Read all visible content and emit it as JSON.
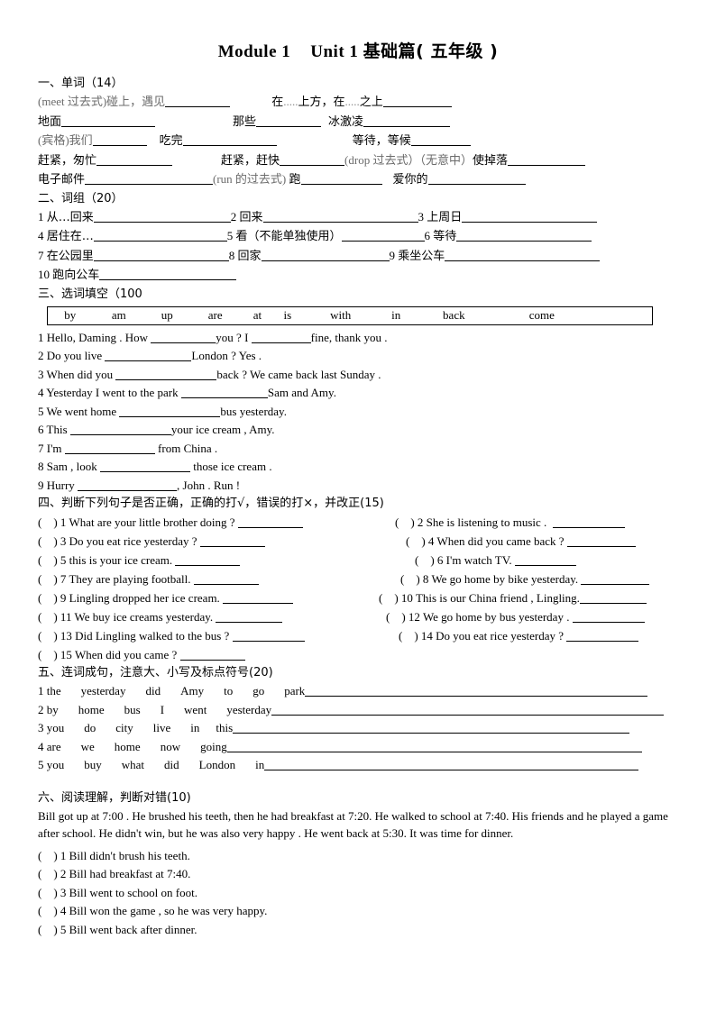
{
  "document": {
    "title_part1": "Module 1",
    "title_part2": "Unit 1",
    "title_part3": "基础篇( 五年级 )"
  },
  "section1": {
    "heading": "一、单词（14）",
    "items": [
      {
        "hint": "(meet  过去式)",
        "cn": "碰上，遇见",
        "blank": 72
      },
      {
        "hint": "",
        "cn": "在",
        "dots": ".....",
        "cn2": "上方，在",
        "dots2": ".....",
        "cn3": "之上",
        "blank": 76
      },
      {
        "hint": "",
        "cn": "地面",
        "blank": 104
      },
      {
        "hint": "",
        "cn": "那些",
        "blank": 72
      },
      {
        "hint": "",
        "cn": "冰激凌",
        "blank": 96
      },
      {
        "hint": "(宾格)",
        "cn": "我们",
        "blank": 60
      },
      {
        "hint": "",
        "cn": "吃完",
        "blank": 104
      },
      {
        "hint": "",
        "cn": "等待，等候",
        "blank": 66
      },
      {
        "hint": "",
        "cn": "赶紧，匆忙",
        "blank": 84
      },
      {
        "hint": "",
        "cn": "赶紧，赶快",
        "blank": 72
      },
      {
        "hint": "(drop  过去式）（无意中）",
        "cn": "使掉落",
        "blank": 86
      },
      {
        "hint": "",
        "cn": "电子邮件",
        "blank": 142
      },
      {
        "hint": "(run  的过去式)",
        "cn": "跑",
        "blank": 90
      },
      {
        "hint": "",
        "cn": "爱你的",
        "blank": 108
      }
    ],
    "line2_label_a": "(meet  过去式)碰上，遇见",
    "line2_label_b": "在",
    "line2_label_c": "上方，在",
    "line2_label_d": "之上",
    "line3_a": "地面",
    "line3_b": "那些",
    "line3_c": "冰激凌",
    "line4_a": "(宾格)我们",
    "line4_b": "吃完",
    "line4_c": "等待，等候",
    "line5_a": "赶紧，匆忙",
    "line5_b": "赶紧，赶快",
    "line5_c_hint": "(drop  过去式）（无意中）",
    "line5_c": "使掉落",
    "line6_a": "电子邮件",
    "line6_b_hint": "(run  的过去式)",
    "line6_b": "跑",
    "line6_c": "爱你的"
  },
  "section2": {
    "heading": "二、词组（20）",
    "items": [
      {
        "num": "1",
        "text": "从…回来"
      },
      {
        "num": "2",
        "text": "回来"
      },
      {
        "num": "3",
        "text": "上周日"
      },
      {
        "num": "4",
        "text": "居住在…"
      },
      {
        "num": "5",
        "text": "看（不能单独使用）"
      },
      {
        "num": "6",
        "text": "等待"
      },
      {
        "num": "7",
        "text": "在公园里"
      },
      {
        "num": "8",
        "text": "回家"
      },
      {
        "num": "9",
        "text": "乘坐公车"
      },
      {
        "num": "10",
        "text": "跑向公车"
      }
    ]
  },
  "section3": {
    "heading": "三、选词填空（100",
    "wordbank": [
      "by",
      "am",
      "up",
      "are",
      "at",
      "is",
      "with",
      "in",
      "back",
      "come"
    ],
    "sentences": [
      {
        "num": "1",
        "pre": "Hello, Daming . How",
        "blank1": 72,
        "mid": "you ? I",
        "blank2": 66,
        "post": "fine, thank you ."
      },
      {
        "num": "2",
        "pre": "Do you live",
        "blank1": 96,
        "mid": "London ? Yes .",
        "blank2": 0,
        "post": ""
      },
      {
        "num": "3",
        "pre": "When did you",
        "blank1": 112,
        "mid": "back ?   We came back last Sunday .",
        "blank2": 0,
        "post": ""
      },
      {
        "num": "4",
        "pre": "Yesterday I went to the park",
        "blank1": 96,
        "mid": "Sam and Amy.",
        "blank2": 0,
        "post": ""
      },
      {
        "num": "5",
        "pre": "We went home",
        "blank1": 112,
        "mid": "bus yesterday.",
        "blank2": 0,
        "post": ""
      },
      {
        "num": "6",
        "pre": "This",
        "blank1": 112,
        "mid": "your ice cream , Amy.",
        "blank2": 0,
        "post": ""
      },
      {
        "num": "7",
        "pre": "I'm",
        "blank1": 100,
        "mid": " from China .",
        "blank2": 0,
        "post": ""
      },
      {
        "num": "8",
        "pre": "Sam , look",
        "blank1": 100,
        "mid": " those ice cream .",
        "blank2": 0,
        "post": ""
      },
      {
        "num": "9",
        "pre": "Hurry",
        "blank1": 110,
        "mid": ", John . Run !",
        "blank2": 0,
        "post": ""
      }
    ]
  },
  "section4": {
    "heading": "四、判断下列句子是否正确，正确的打√，错误的打×，并改正(15)",
    "items": [
      {
        "num": "1",
        "text": "What are your little brother doing ?",
        "blank": 72,
        "col": "left",
        "indent": 0
      },
      {
        "num": "2",
        "text": "She is listening to music .",
        "blank": 80,
        "col": "right",
        "indent": 0
      },
      {
        "num": "3",
        "text": "Do you eat rice yesterday ?",
        "blank": 72,
        "col": "left",
        "indent": 0
      },
      {
        "num": "4",
        "text": "When did you came back ?",
        "blank": 76,
        "col": "right",
        "indent": 12
      },
      {
        "num": "5",
        "text": "this is your ice cream.",
        "blank": 72,
        "col": "left",
        "indent": 0
      },
      {
        "num": "6",
        "text": "I'm watch TV.",
        "blank": 68,
        "col": "right",
        "indent": 24
      },
      {
        "num": "7",
        "text": "They are playing football.",
        "blank": 72,
        "col": "left",
        "indent": 0
      },
      {
        "num": "8",
        "text": "We go home by bike yesterday.",
        "blank": 76,
        "col": "right",
        "indent": 10
      },
      {
        "num": "9",
        "text": "Lingling dropped her ice cream.",
        "blank": 78,
        "col": "left",
        "indent": 0
      },
      {
        "num": "10",
        "text": "This is our China friend , Lingling.",
        "blank": 74,
        "col": "right",
        "indent": -16
      },
      {
        "num": "11",
        "text": "We buy ice creams yesterday.",
        "blank": 74,
        "col": "left",
        "indent": 0
      },
      {
        "num": "12",
        "text": "We go home by bus yesterday .",
        "blank": 80,
        "col": "right",
        "indent": -8
      },
      {
        "num": "13",
        "text": "Did Lingling walked to the bus ?",
        "blank": 80,
        "col": "left",
        "indent": 0
      },
      {
        "num": "14",
        "text": "Do you eat rice yesterday ?",
        "blank": 80,
        "col": "right",
        "indent": 6
      },
      {
        "num": "15",
        "text": "When did you came ?",
        "blank": 72,
        "col": "left",
        "indent": 0
      }
    ]
  },
  "section5": {
    "heading": "五、连词成句，注意大、小写及标点符号(20)",
    "items": [
      {
        "num": "1",
        "words": [
          "the",
          "yesterday",
          "did",
          "Amy",
          "to",
          "go",
          "park"
        ],
        "blank": 380
      },
      {
        "num": "2",
        "words": [
          "by",
          "home",
          "bus",
          "I",
          "went",
          "yesterday"
        ],
        "blank": 435
      },
      {
        "num": "3",
        "words": [
          "you",
          "do",
          "city",
          "live",
          "in",
          "this"
        ],
        "blank": 440
      },
      {
        "num": "4",
        "words": [
          "are",
          "we",
          "home",
          "now",
          "going"
        ],
        "blank": 460
      },
      {
        "num": "5",
        "words": [
          "you",
          "buy",
          "what",
          "did",
          "London",
          "in"
        ],
        "blank": 415
      }
    ]
  },
  "section6": {
    "heading": "六、阅读理解，判断对错(10)",
    "passage": "Bill got up at 7:00 . He brushed his teeth, then he had breakfast at 7:20. He walked to school at 7:40. His friends and he played a game after school. He didn't win, but he was also very happy . He went back at 5:30. It was time for dinner.",
    "items": [
      {
        "num": "1",
        "text": "Bill didn't brush his teeth."
      },
      {
        "num": "2",
        "text": "Bill had breakfast at 7:40."
      },
      {
        "num": "3",
        "text": "Bill went to school on foot."
      },
      {
        "num": "4",
        "text": "Bill won the game , so he was very happy."
      },
      {
        "num": "5",
        "text": "Bill went back after dinner."
      }
    ]
  }
}
